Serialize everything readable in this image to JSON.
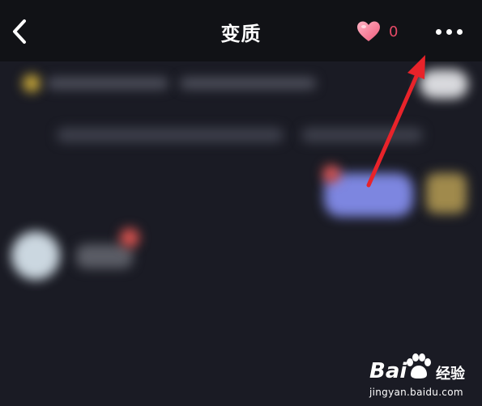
{
  "header": {
    "title": "变质",
    "like_count": "0",
    "back_icon": "chevron-left-icon",
    "like_icon": "heart-icon",
    "more_icon": "more-horizontal-icon"
  },
  "watermark": {
    "logo_text": "Bai",
    "logo_suffix": "经验",
    "url": "jingyan.baidu.com"
  },
  "colors": {
    "header_bg": "#111216",
    "content_bg": "#1a1b24",
    "like_accent": "#e74a67",
    "annotation_arrow": "#e8232a"
  }
}
